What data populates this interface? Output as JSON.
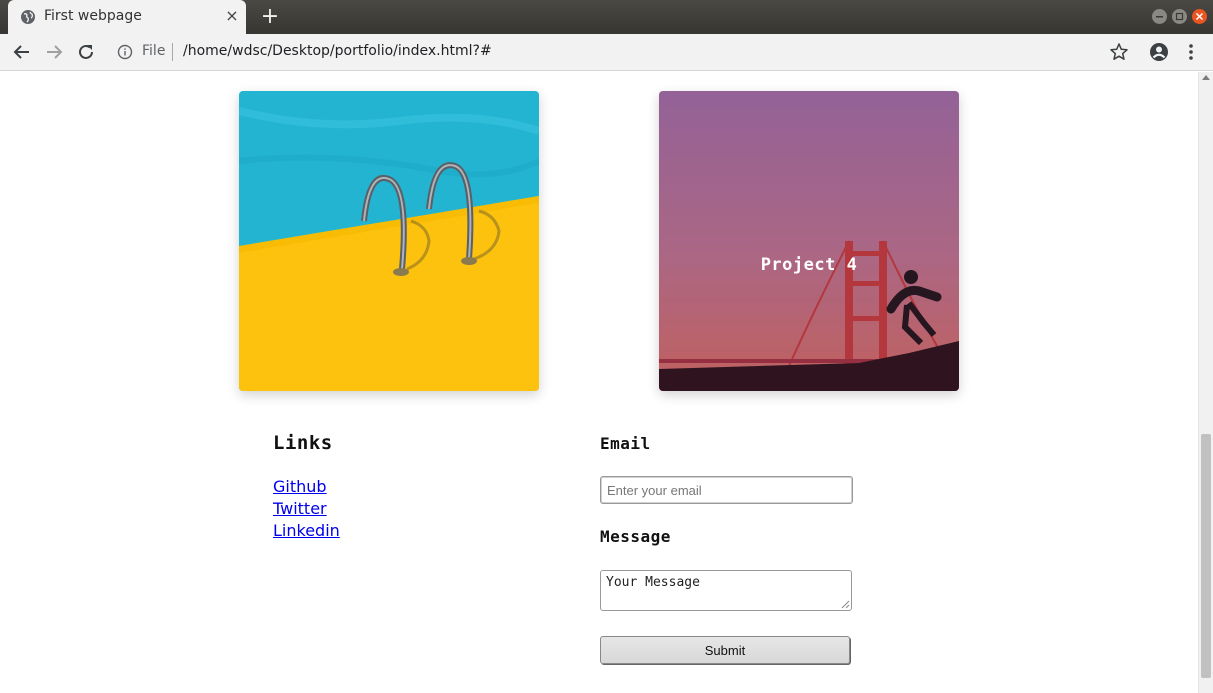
{
  "browser": {
    "tab_title": "First webpage",
    "tab_close": "×",
    "new_tab": "+",
    "scheme_label": "File",
    "url": "/home/wdsc/Desktop/portfolio/index.html?#",
    "icons": [
      "globe-icon",
      "back-arrow-icon",
      "forward-arrow-icon",
      "reload-icon",
      "info-icon",
      "star-icon",
      "profile-icon",
      "kebab-menu-icon",
      "minimize-icon",
      "maximize-icon",
      "close-icon"
    ],
    "colors": {
      "titlebar": "#3a3935",
      "toolbar": "#f2f2f2",
      "close_button": "#e95420"
    }
  },
  "projects": [
    {
      "label": "",
      "image": "pool-ladder-photo"
    },
    {
      "label": "Project 4",
      "image": "golden-gate-skater-photo"
    }
  ],
  "links": {
    "heading": "Links",
    "items": [
      "Github",
      "Twitter",
      "Linkedin"
    ]
  },
  "contact": {
    "email_label": "Email",
    "email_placeholder": "Enter your email",
    "email_value": "",
    "message_label": "Message",
    "message_value": "Your Message",
    "submit_label": "Submit"
  }
}
